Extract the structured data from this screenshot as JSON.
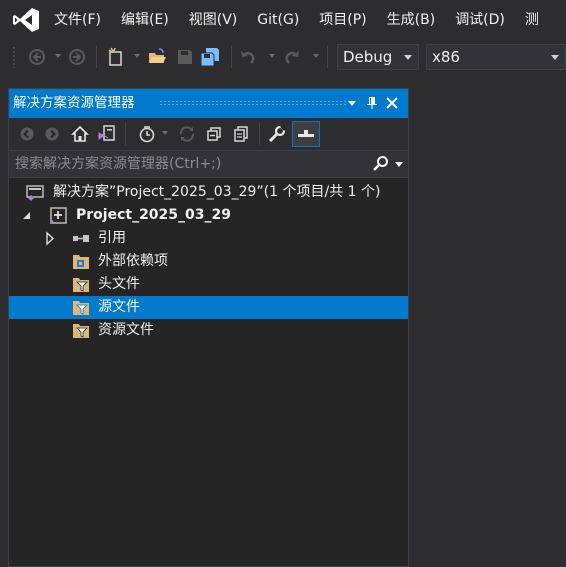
{
  "menu": {
    "items": [
      "文件(F)",
      "编辑(E)",
      "视图(V)",
      "Git(G)",
      "项目(P)",
      "生成(B)",
      "调试(D)",
      "测"
    ]
  },
  "toolbar": {
    "configuration": "Debug",
    "platform": "x86"
  },
  "solution_explorer": {
    "title": "解决方案资源管理器",
    "search_placeholder": "搜索解决方案资源管理器(Ctrl+;)",
    "tree": {
      "solution": "解决方案”Project_2025_03_29”(1 个项目/共 1 个)",
      "project": "Project_2025_03_29",
      "references": "引用",
      "external_deps": "外部依赖项",
      "header_files": "头文件",
      "source_files": "源文件",
      "resource_files": "资源文件"
    }
  },
  "colors": {
    "accent": "#007acc",
    "background": "#2d2d30",
    "panel": "#252526"
  },
  "icons": [
    "visual-studio-logo",
    "back-icon",
    "forward-icon",
    "new-item-icon",
    "open-folder-icon",
    "save-icon",
    "save-all-icon",
    "undo-icon",
    "redo-icon",
    "dropdown-icon",
    "pin-icon",
    "close-icon",
    "home-icon",
    "switch-views-icon",
    "pending-changes-icon",
    "sync-icon",
    "collapse-all-icon",
    "show-all-files-icon",
    "properties-icon",
    "preview-icon",
    "search-icon",
    "solution-icon",
    "project-icon",
    "references-icon",
    "filter-folder-icon"
  ]
}
